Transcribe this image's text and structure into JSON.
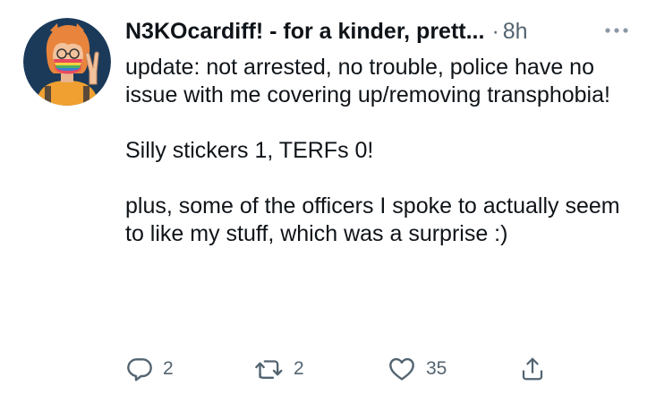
{
  "tweet": {
    "author": {
      "display_name": "N3KOcardiff! - for a kinder, prett...",
      "avatar_icon": "cartoon-avatar-peace-sign"
    },
    "separator": "·",
    "time": "8h",
    "more_icon": "more-horizontal-icon",
    "text": {
      "paragraph_1": "update: not arrested, no trouble, police have no issue with me covering up/removing transphobia!",
      "paragraph_2": "Silly stickers 1, TERFs 0!",
      "paragraph_3": "plus, some of the officers I spoke to actually seem to like my stuff, which was a surprise :)"
    },
    "actions": {
      "reply": {
        "icon": "reply-icon",
        "count": "2"
      },
      "retweet": {
        "icon": "retweet-icon",
        "count": "2"
      },
      "like": {
        "icon": "heart-icon",
        "count": "35"
      },
      "share": {
        "icon": "share-icon"
      }
    }
  },
  "colors": {
    "text_primary": "#0f1419",
    "text_secondary": "#536471",
    "avatar_background": "#1b3a5a",
    "avatar_hair": "#e8843c",
    "avatar_shirt": "#f0a030"
  }
}
